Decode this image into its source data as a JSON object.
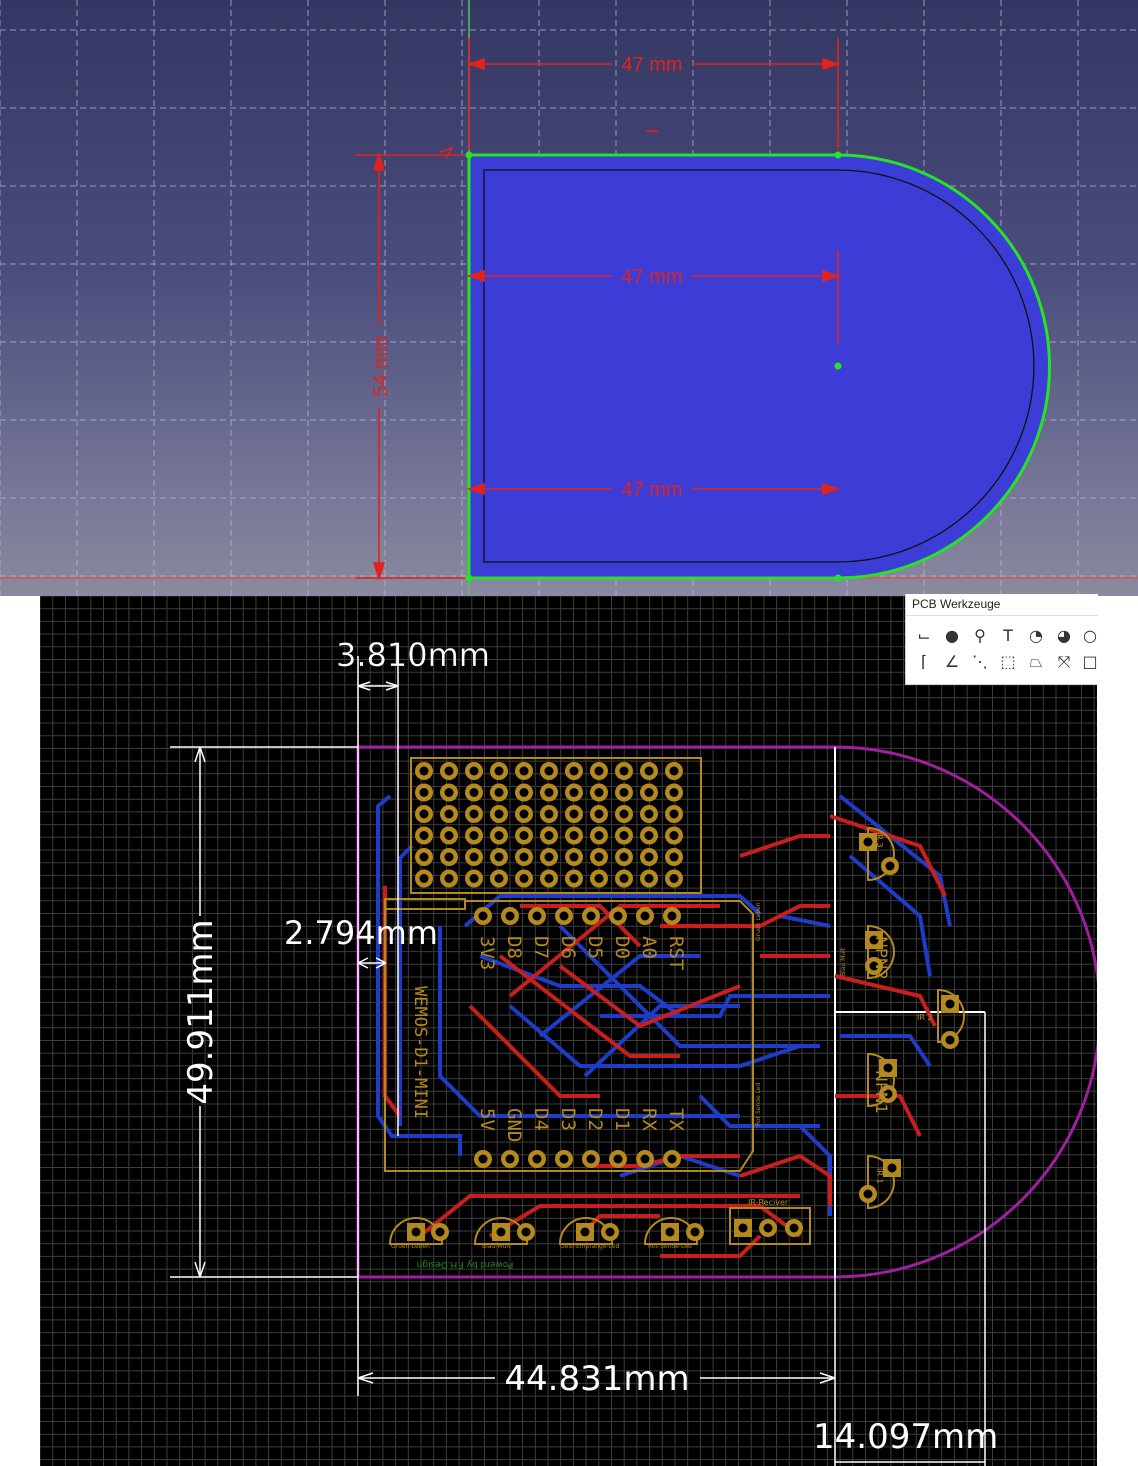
{
  "cad": {
    "dim_top": "47 mm",
    "dim_middle": "47 mm",
    "dim_bottom": "47 mm",
    "dim_height": "54 mm",
    "colors": {
      "fill": "#3c3ed4",
      "outline": "#22dd22",
      "dimension": "#e0231c",
      "grid": "#b8bad4"
    }
  },
  "pcb": {
    "toolbar_title": "PCB Werkzeuge",
    "tools_row1": [
      "route-icon",
      "via-icon",
      "signal-icon",
      "text-icon",
      "arc-cw-icon",
      "arc-ccw-icon",
      "circle-icon"
    ],
    "tools_row2": [
      "wire-icon",
      "angle-icon",
      "ratsnest-icon",
      "rect-icon",
      "polygon-icon",
      "ripup-icon",
      "frame-icon"
    ],
    "dim_top": "3.810mm",
    "dim_inner": "2.794mm",
    "dim_height": "49.911mm",
    "dim_width": "44.831mm",
    "dim_arc": "14.097mm",
    "module_label": "WEMOS-D1-MINI",
    "top_pins": [
      "RST",
      "A0",
      "D0",
      "D5",
      "D6",
      "D7",
      "D8",
      "3V3"
    ],
    "bottom_pins": [
      "TX",
      "RX",
      "D1",
      "D2",
      "D3",
      "D4",
      "GND",
      "5V"
    ],
    "npn": [
      "NPN1",
      "NPN2"
    ],
    "ir": [
      "IR 1",
      "IR 2",
      "IR 3"
    ],
    "ir_receiver": "IR-Reciver",
    "leds": [
      "Gruen-Leben",
      "Blau-Mult",
      "Gelb-Empfange-Led",
      "Rot-Sende-Led"
    ],
    "side_labels": [
      "Gruen Leben",
      "Blau Mult",
      "Rot Sende Led"
    ],
    "credit": "Powerd by F.H.Design",
    "colors": {
      "outline": "#a01ea0",
      "silk": "#b48a1e",
      "top_trace": "#c81e1e",
      "bottom_trace": "#1e3cc8",
      "dim": "#ffffff",
      "grid": "#3a3a3a"
    }
  }
}
